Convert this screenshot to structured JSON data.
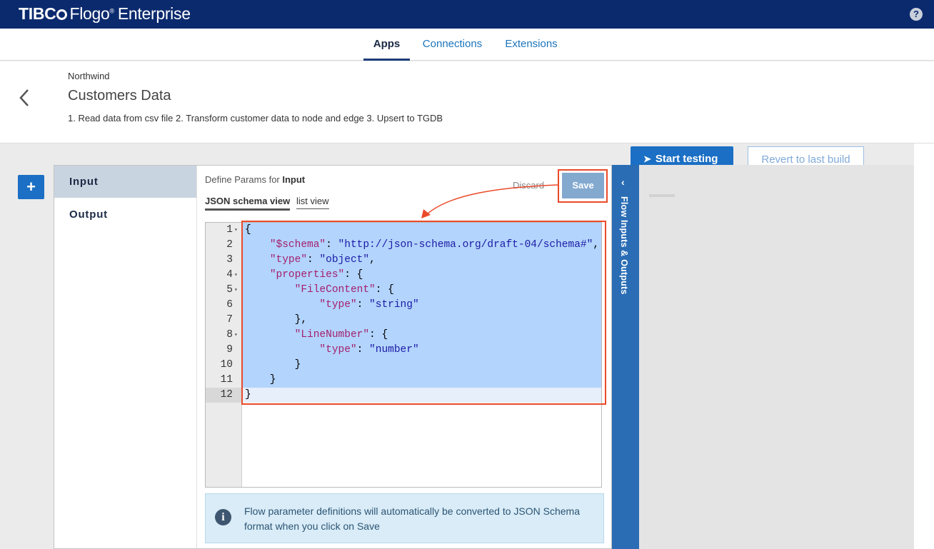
{
  "topbar": {
    "brand_tibco": "TIBC",
    "brand_flogo": "Flogo",
    "brand_reg": "®",
    "brand_enterprise": "Enterprise",
    "help_label": "?"
  },
  "nav": {
    "tabs": [
      {
        "label": "Apps",
        "active": true
      },
      {
        "label": "Connections",
        "active": false
      },
      {
        "label": "Extensions",
        "active": false
      }
    ]
  },
  "header": {
    "breadcrumb": "Northwind",
    "title": "Customers Data",
    "description": "1. Read data from csv file 2. Transform customer data to node and edge 3. Upsert to TGDB"
  },
  "actions": {
    "start_testing": "Start testing",
    "revert": "Revert to last build",
    "add_label": "+"
  },
  "side_menu": {
    "items": [
      {
        "label": "Input",
        "active": true
      },
      {
        "label": "Output",
        "active": false
      }
    ]
  },
  "params": {
    "define_prefix": "Define Params for ",
    "define_target": "Input",
    "subtab_json": "JSON schema view",
    "subtab_list": "list view",
    "discard": "Discard",
    "save": "Save"
  },
  "editor": {
    "lines": [
      {
        "n": "1",
        "fold": true,
        "text": "{"
      },
      {
        "n": "2",
        "fold": false,
        "text": "    \"$schema\": \"http://json-schema.org/draft-04/schema#\","
      },
      {
        "n": "3",
        "fold": false,
        "text": "    \"type\": \"object\","
      },
      {
        "n": "4",
        "fold": true,
        "text": "    \"properties\": {"
      },
      {
        "n": "5",
        "fold": true,
        "text": "        \"FileContent\": {"
      },
      {
        "n": "6",
        "fold": false,
        "text": "            \"type\": \"string\""
      },
      {
        "n": "7",
        "fold": false,
        "text": "        },"
      },
      {
        "n": "8",
        "fold": true,
        "text": "        \"LineNumber\": {"
      },
      {
        "n": "9",
        "fold": false,
        "text": "            \"type\": \"number\""
      },
      {
        "n": "10",
        "fold": false,
        "text": "        }"
      },
      {
        "n": "11",
        "fold": false,
        "text": "    }"
      },
      {
        "n": "12",
        "fold": false,
        "text": "}"
      }
    ],
    "current_line": 12
  },
  "info": {
    "icon": "info-icon",
    "text": "Flow parameter definitions will automatically be converted to JSON Schema format when you click on Save"
  },
  "flow_panel": {
    "label": "Flow Inputs & Outputs",
    "chevron": "‹"
  },
  "colors": {
    "topbar": "#0b2a6e",
    "accent": "#1b6fc4",
    "annotation": "#ea4a2a",
    "selection": "#b3d4fc"
  }
}
